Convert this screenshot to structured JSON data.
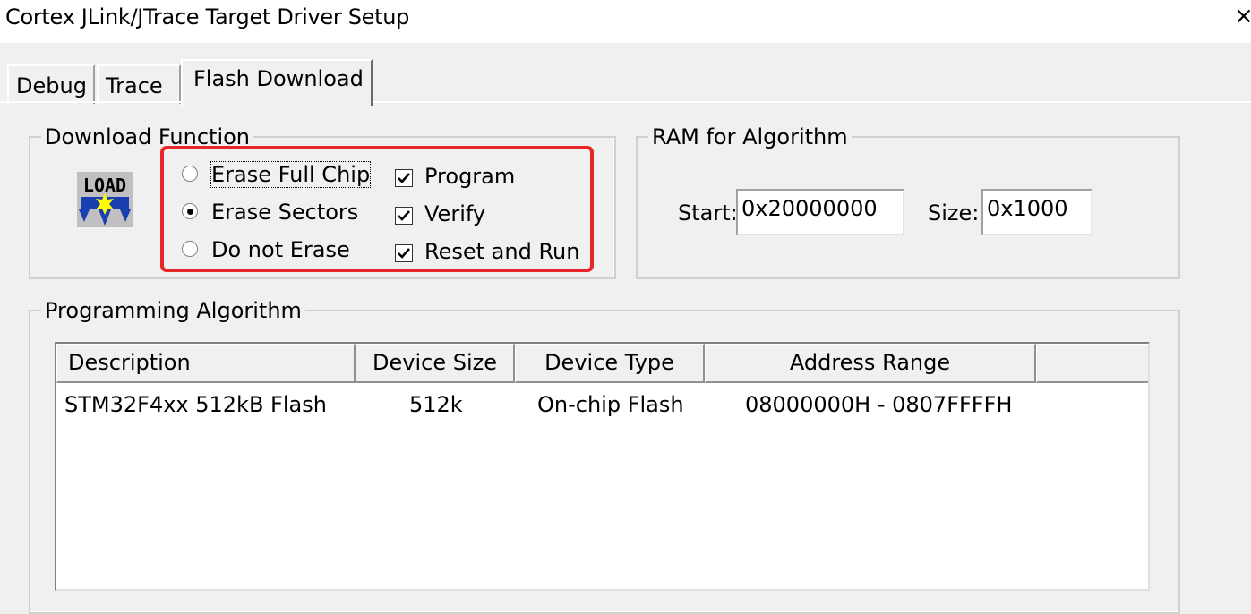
{
  "window": {
    "title": "Cortex JLink/JTrace Target Driver Setup",
    "close_glyph": "×"
  },
  "tabs": [
    {
      "label": "Debug",
      "active": false
    },
    {
      "label": "Trace",
      "active": false
    },
    {
      "label": "Flash Download",
      "active": true
    }
  ],
  "download_function": {
    "legend": "Download Function",
    "load_icon_text": "LOAD",
    "erase_options": [
      {
        "label": "Erase Full Chip",
        "selected": false
      },
      {
        "label": "Erase Sectors",
        "selected": true
      },
      {
        "label": "Do not Erase",
        "selected": false
      }
    ],
    "checkboxes": [
      {
        "label": "Program",
        "checked": true
      },
      {
        "label": "Verify",
        "checked": true
      },
      {
        "label": "Reset and Run",
        "checked": true
      }
    ],
    "highlight_color": "#e8272a"
  },
  "ram_for_algorithm": {
    "legend": "RAM for Algorithm",
    "start_label": "Start:",
    "start_value": "0x20000000",
    "size_label": "Size:",
    "size_value": "0x1000"
  },
  "programming_algorithm": {
    "legend": "Programming Algorithm",
    "columns": [
      "Description",
      "Device Size",
      "Device Type",
      "Address Range"
    ],
    "rows": [
      [
        "STM32F4xx 512kB Flash",
        "512k",
        "On-chip Flash",
        "08000000H - 0807FFFFH"
      ]
    ]
  }
}
